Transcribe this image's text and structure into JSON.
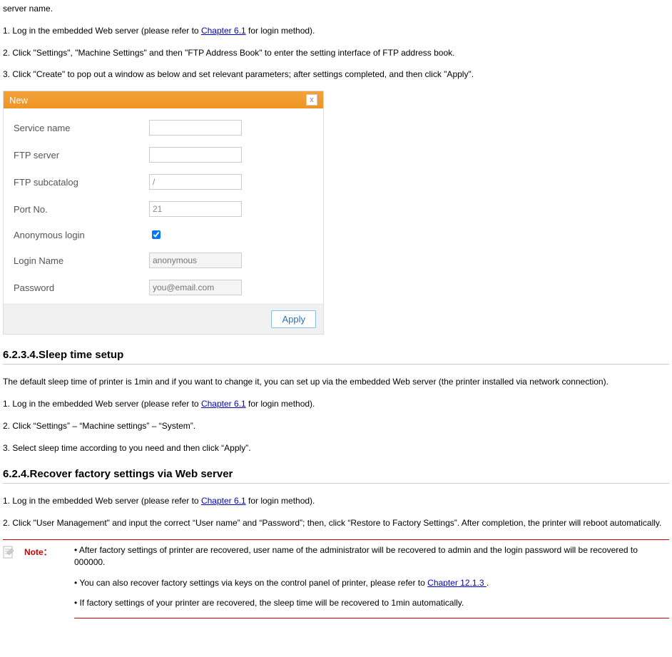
{
  "intro": {
    "frag": "server name.",
    "step1a": "1. Log in the embedded Web server (please refer to ",
    "step1_link": "Chapter 6.1",
    "step1b": " for login method).",
    "step2": "2. Click \"Settings\", \"Machine Settings\" and then \"FTP Address Book\" to enter the setting interface of FTP address book.",
    "step3": "3. Click \"Create\" to pop out a window as below and set relevant parameters; after settings completed, and then click \"Apply\"."
  },
  "dialog": {
    "title": "New",
    "labels": {
      "service": "Service name",
      "ftp": "FTP server",
      "sub": "FTP subcatalog",
      "port": "Port No.",
      "anon": "Anonymous login",
      "login": "Login Name",
      "pass": "Password"
    },
    "values": {
      "sub": "/",
      "port": "21",
      "login_ph": "anonymous",
      "pass_ph": "you@email.com"
    },
    "apply": "Apply"
  },
  "sec_sleep": {
    "title": "6.2.3.4.Sleep time setup",
    "p1": "The default sleep time of printer is 1min and if you want to change it, you can set up via the embedded Web server (the printer installed via network connection).",
    "s1a": "1. Log in the embedded Web server (please refer to ",
    "s1_link": "Chapter 6.1",
    "s1b": " for login method).",
    "s2": "2. Click “Settings” – “Machine settings” – “System”.",
    "s3": "3. Select sleep time according to you need and then click “Apply”."
  },
  "sec_recover": {
    "title": "6.2.4.Recover factory settings via Web server",
    "s1a": "1. Log in the embedded Web server (please refer to ",
    "s1_link": "Chapter 6.1",
    "s1b": " for login method).",
    "s2": "2. Click \"User Management\" and input the correct “User name” and “Password”; then, click “Restore to Factory Settings”. After completion, the printer will reboot automatically."
  },
  "note": {
    "label": "Note：",
    "b1": "• After factory settings of printer are recovered, user name of the administrator will be recovered to admin and the login password will be recovered to 000000.",
    "b2a": "• You can also recover factory settings via keys on the control panel of printer, please refer to ",
    "b2_link": "Chapter 12.1.3 ",
    "b2b": ".",
    "b3": "• If factory settings of your printer are recovered, the sleep time will be recovered to 1min automatically."
  }
}
